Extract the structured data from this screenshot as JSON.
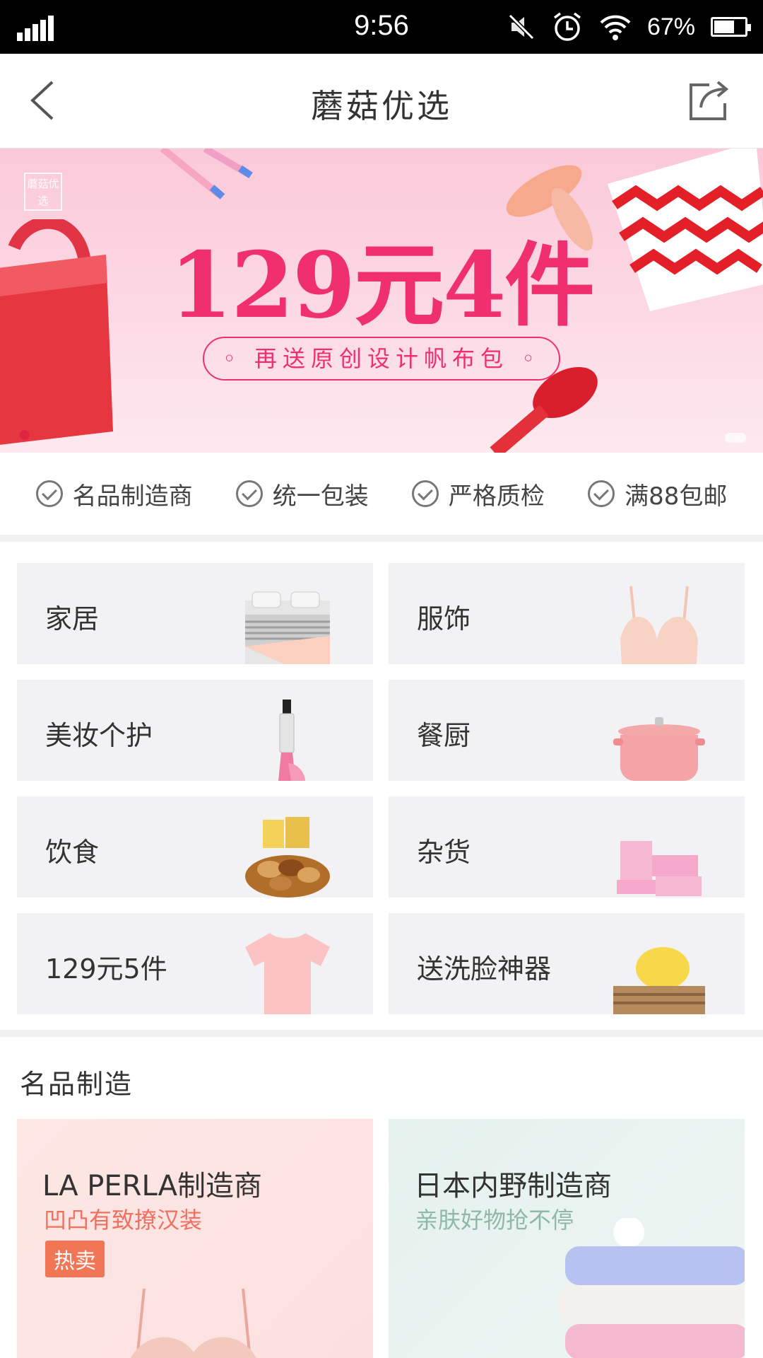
{
  "status_bar": {
    "time": "9:56",
    "battery": "67%",
    "battery_level": 0.67
  },
  "nav": {
    "title": "蘑菇优选",
    "back_icon": "chevron-left-icon",
    "share_icon": "share-icon"
  },
  "banner": {
    "logo": "蘑菇优选",
    "headline": "129元4件",
    "subtext": "◦ 再送原创设计帆布包 ◦"
  },
  "features": [
    {
      "label": "名品制造商"
    },
    {
      "label": "统一包装"
    },
    {
      "label": "严格质检"
    },
    {
      "label": "满88包邮"
    }
  ],
  "categories": [
    {
      "label": "家居",
      "icon": "bed-icon"
    },
    {
      "label": "服饰",
      "icon": "bra-icon"
    },
    {
      "label": "美妆个护",
      "icon": "curling-iron-icon"
    },
    {
      "label": "餐厨",
      "icon": "pot-icon"
    },
    {
      "label": "饮食",
      "icon": "nuts-icon"
    },
    {
      "label": "杂货",
      "icon": "storage-bags-icon"
    },
    {
      "label": "129元5件",
      "icon": "tshirt-icon"
    },
    {
      "label": "送洗脸神器",
      "icon": "sponge-icon"
    }
  ],
  "section": {
    "title": "名品制造"
  },
  "makers": [
    {
      "title": "LA PERLA制造商",
      "subtitle": "凹凸有致撩汉装",
      "badge": "热卖"
    },
    {
      "title": "日本内野制造商",
      "subtitle": "亲肤好物抢不停",
      "badge": ""
    }
  ],
  "colors": {
    "accent": "#f0306e",
    "badge": "#f07656",
    "tile_bg": "#f2f2f4"
  }
}
